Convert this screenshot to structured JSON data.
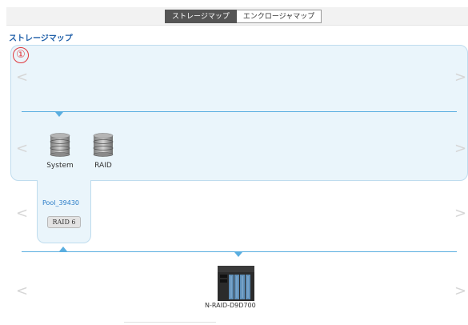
{
  "tabs": [
    {
      "label": "ストレージマップ",
      "active": true
    },
    {
      "label": "エンクロージャマップ",
      "active": false
    }
  ],
  "section_title": "ストレージマップ",
  "callout_number": "①",
  "disks": [
    {
      "label": "System",
      "icon": "disk-stack-icon"
    },
    {
      "label": "RAID",
      "icon": "disk-stack-icon"
    }
  ],
  "pool": {
    "name": "Pool_39430",
    "raid_label": "RAID 6"
  },
  "enclosure": {
    "name": "N-RAID-D9D700",
    "icon": "nas-enclosure-icon"
  },
  "nav": {
    "prev": "<",
    "next": ">"
  },
  "colors": {
    "accent": "#5aaee0",
    "highlight_bg": "#eaf5fb",
    "title_blue": "#1f5fa8",
    "callout_red": "#e0383e"
  }
}
